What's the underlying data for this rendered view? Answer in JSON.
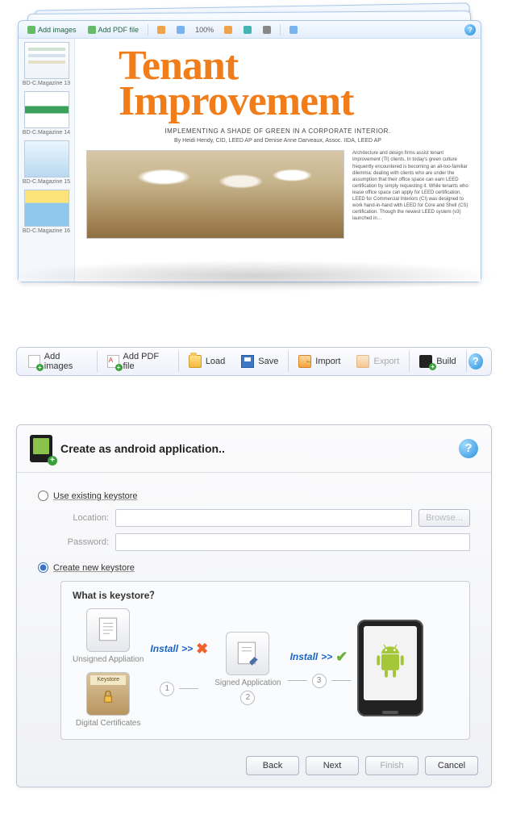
{
  "editor": {
    "toolbar": {
      "add_images": "Add images",
      "add_pdf": "Add PDF file",
      "zoom": "100%"
    },
    "thumbs": [
      {
        "label": "BD-C.Magazine 13"
      },
      {
        "label": "BD-C.Magazine 14"
      },
      {
        "label": "BD-C.Magazine 15"
      },
      {
        "label": "BD-C.Magazine 16"
      }
    ],
    "page": {
      "title_l1": "Tenant",
      "title_l2": "Improvement",
      "subtitle": "IMPLEMENTING A SHADE OF GREEN IN A CORPORATE INTERIOR.",
      "byline": "By Heidi Hendy, CID, LEED AP and Denise Anne Darveaux, Assoc. IIDA, LEED AP",
      "body": "Architecture and design firms assist tenant improvement (TI) clients. In today's green culture frequently encountered is becoming an all-too-familiar dilemma: dealing with clients who are under the assumption that their office space can earn LEED certification by simply requesting it. While tenants who lease office space can apply for LEED certification, LEED for Commercial Interiors (CI) was designed to work hand-in-hand with LEED for Core and Shell (CS) certification. Though the newest LEED system (v3) launched in…"
    }
  },
  "mainToolbar": {
    "add_images": "Add images",
    "add_pdf": "Add PDF file",
    "load": "Load",
    "save": "Save",
    "import": "Import",
    "export": "Export",
    "build": "Build"
  },
  "dialog": {
    "title": "Create as android application..",
    "radio_existing": "Use existing keystore",
    "radio_new": "Create new keystore",
    "location_label": "Location:",
    "password_label": "Password:",
    "browse": "Browse...",
    "diagram": {
      "heading": "What is keystore？",
      "unsigned": "Unsigned Appliation",
      "certs": "Digital Certificates",
      "signed": "Signed Application",
      "install": "Install",
      "step1": "1",
      "step2": "2",
      "step3": "3",
      "keystore_badge": "Keystore"
    },
    "buttons": {
      "back": "Back",
      "next": "Next",
      "finish": "Finish",
      "cancel": "Cancel"
    }
  }
}
